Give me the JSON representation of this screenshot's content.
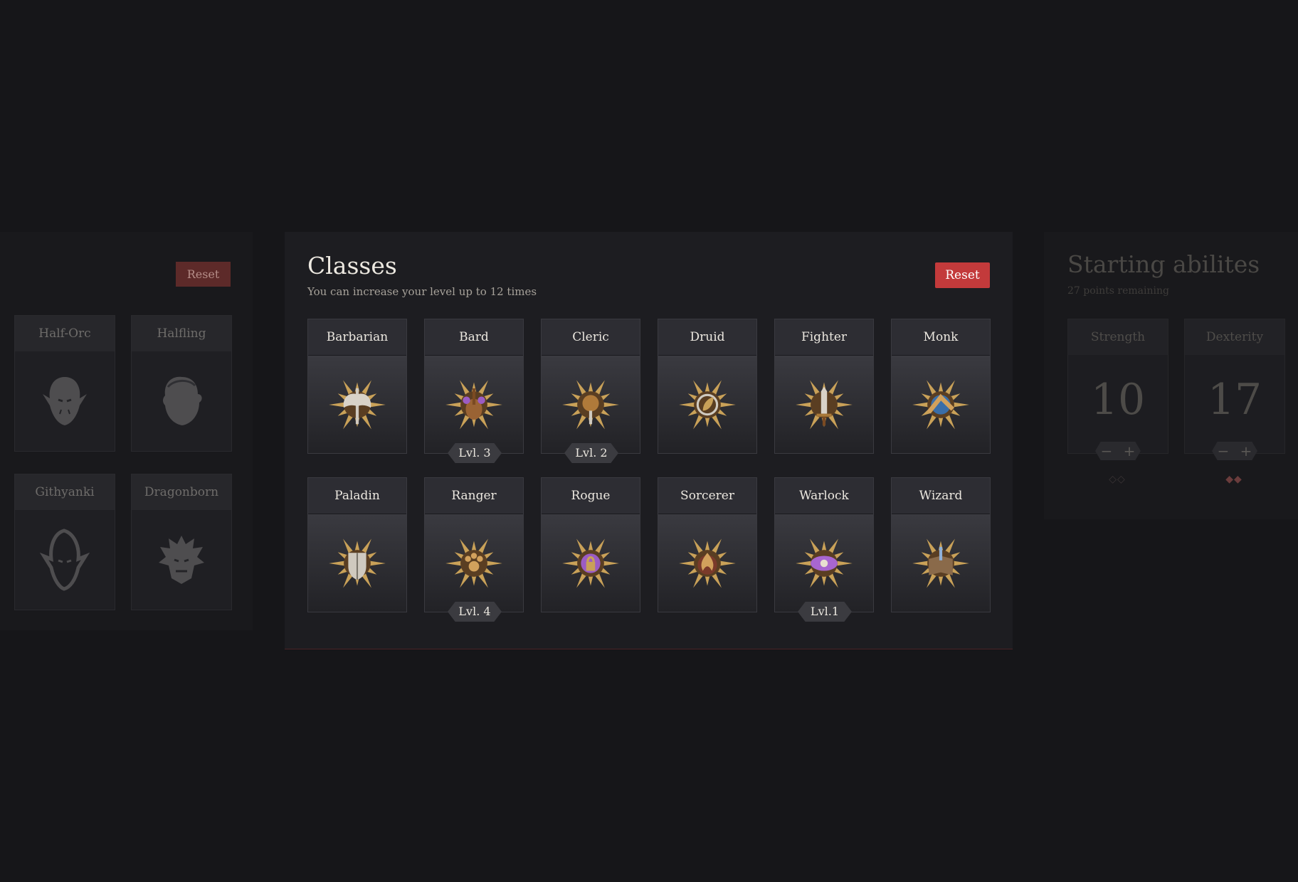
{
  "left_panel": {
    "reset_label": "Reset",
    "races": [
      {
        "label": "Half-Orc",
        "icon": "half-orc-icon"
      },
      {
        "label": "Halfling",
        "icon": "halfling-icon"
      },
      {
        "label": "Githyanki",
        "icon": "githyanki-icon"
      },
      {
        "label": "Dragonborn",
        "icon": "dragonborn-icon"
      }
    ]
  },
  "main_panel": {
    "title": "Classes",
    "subtitle": "You can increase your level up to 12 times",
    "reset_label": "Reset",
    "classes": [
      {
        "label": "Barbarian",
        "level": "",
        "icon": "axe-emblem-icon"
      },
      {
        "label": "Bard",
        "level": "Lvl. 3",
        "icon": "lute-emblem-icon"
      },
      {
        "label": "Cleric",
        "level": "Lvl. 2",
        "icon": "mace-emblem-icon"
      },
      {
        "label": "Druid",
        "level": "",
        "icon": "leaf-emblem-icon"
      },
      {
        "label": "Fighter",
        "level": "",
        "icon": "sword-emblem-icon"
      },
      {
        "label": "Monk",
        "level": "",
        "icon": "fist-emblem-icon"
      },
      {
        "label": "Paladin",
        "level": "",
        "icon": "shield-emblem-icon"
      },
      {
        "label": "Ranger",
        "level": "Lvl. 4",
        "icon": "paw-emblem-icon"
      },
      {
        "label": "Rogue",
        "level": "",
        "icon": "lockpick-emblem-icon"
      },
      {
        "label": "Sorcerer",
        "level": "",
        "icon": "flame-emblem-icon"
      },
      {
        "label": "Warlock",
        "level": "Lvl.1",
        "icon": "eye-emblem-icon"
      },
      {
        "label": "Wizard",
        "level": "",
        "icon": "tome-emblem-icon"
      }
    ]
  },
  "right_panel": {
    "title": "Starting abilites",
    "subtitle": "27 points remaining",
    "abilities": [
      {
        "label": "Strength",
        "value": "10"
      },
      {
        "label": "Dexterity",
        "value": "17"
      }
    ],
    "minus_symbol": "−",
    "plus_symbol": "+"
  },
  "colors": {
    "background": "#161619",
    "panel": "#1d1d21",
    "accent_red": "#c33a3b",
    "gold": "#c9a158"
  }
}
